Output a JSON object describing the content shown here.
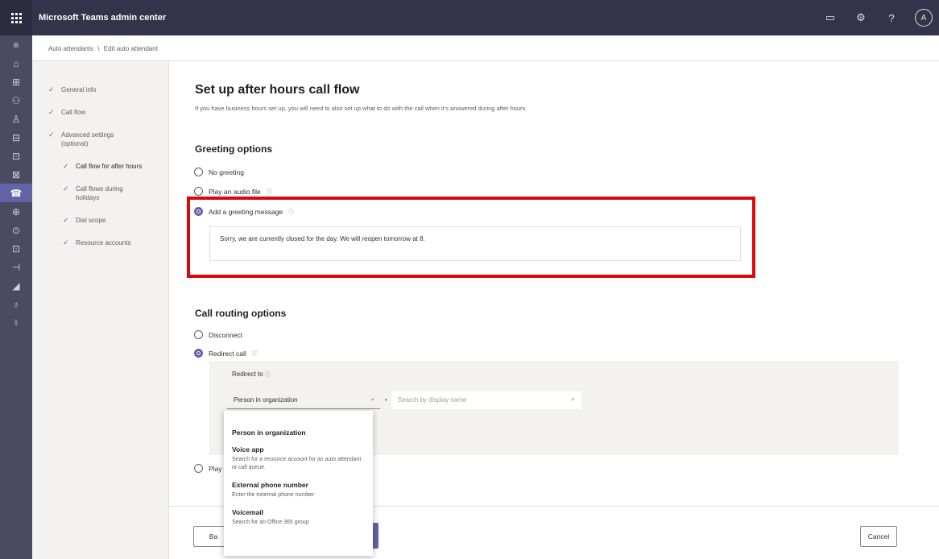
{
  "app": {
    "title": "Microsoft Teams admin center",
    "avatar_initial": "A"
  },
  "topbar_icons": [
    "monitor-icon",
    "gear-icon",
    "help-icon"
  ],
  "topbar_glyphs": {
    "monitor": "▭",
    "gear": "⚙",
    "help": "?"
  },
  "rail": {
    "items": [
      "menu-icon",
      "home-icon",
      "teams-icon",
      "users-icon",
      "devices-icon",
      "locations-icon",
      "meetings-icon",
      "messaging-icon",
      "voice-icon",
      "analytics-icon",
      "policy-packages-icon",
      "planning-icon",
      "notifications-icon",
      "settings-icon",
      "storage-icon",
      "alerts-icon"
    ]
  },
  "rail_glyphs": [
    "≡",
    "⌂",
    "⊞",
    "⚇",
    "♙",
    "⊟",
    "⊡",
    "⊠",
    "☎",
    "⊕",
    "⊙",
    "⊡",
    "⊣",
    "◢",
    "♁",
    "♮"
  ],
  "breadcrumb": {
    "parent": "Auto attendants",
    "separator": "\\",
    "current": "Edit auto attendant"
  },
  "steps": [
    {
      "label": "General info",
      "level": 1
    },
    {
      "label": "Call flow",
      "level": 1
    },
    {
      "label": "Advanced settings (optional)",
      "level": 1
    },
    {
      "label": "Call flow for after hours",
      "level": 2
    },
    {
      "label": "Call flows during holidays",
      "level": 2
    },
    {
      "label": "Dial scope",
      "level": 2
    },
    {
      "label": "Resource accounts",
      "level": 2
    }
  ],
  "page": {
    "title": "Set up after hours call flow",
    "description": "If you have business hours set up, you will need to also set up what to do with the call when it's answered during after hours."
  },
  "greeting": {
    "title": "Greeting options",
    "options": {
      "none": "No greeting",
      "audio": "Play an audio file",
      "message": "Add a greeting message"
    },
    "message_text": "Sorry, we are currently closed for the day. We will reopen tomorrow at 8."
  },
  "routing": {
    "title": "Call routing options",
    "options": {
      "disconnect": "Disconnect",
      "redirect": "Redirect call",
      "play": "Play"
    },
    "redirect_to_label": "Redirect to",
    "selected_target": "Person in organization",
    "search_placeholder": "Search by display name"
  },
  "dropdown": {
    "person_title": "Person in organization",
    "voice_title": "Voice app",
    "voice_desc": "Search for a resource account for an auto attendant or call queue.",
    "external_title": "External phone number",
    "external_desc": "Enter the external phone number",
    "voicemail_title": "Voicemail",
    "voicemail_desc": "Search for an Office 365 group"
  },
  "footer": {
    "back_label": "Ba",
    "cancel_label": "Cancel"
  },
  "colors": {
    "accent": "#6264a7",
    "highlight_border": "#d50a0a",
    "topbar": "#33344a",
    "rail": "#4a4b63"
  }
}
